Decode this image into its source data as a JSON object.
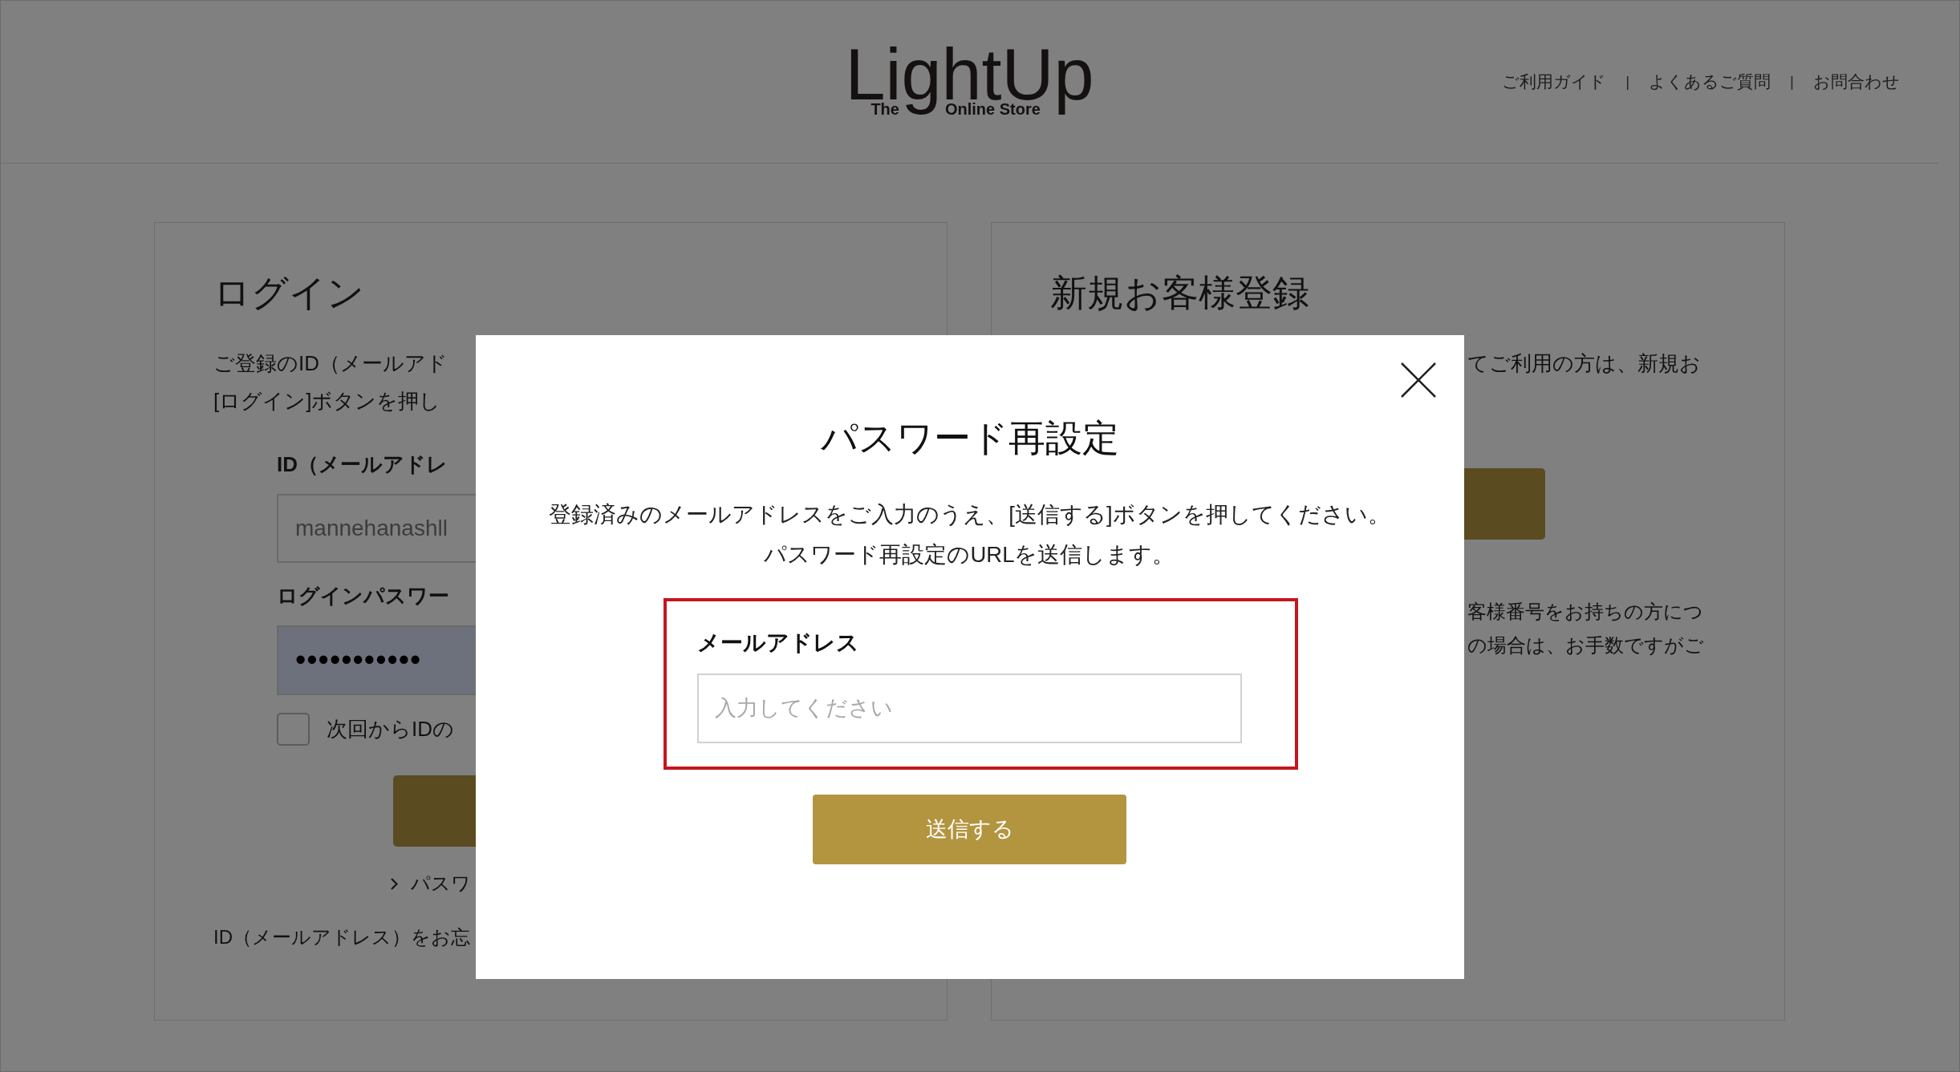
{
  "header": {
    "logo": {
      "wordmark": "LightUp",
      "tagline": [
        "The",
        "Online Store"
      ]
    },
    "links": [
      {
        "kind": "link",
        "label": "ご利用ガイド"
      },
      {
        "kind": "separator",
        "label": "|"
      },
      {
        "kind": "link",
        "label": "よくあるご質問"
      },
      {
        "kind": "separator",
        "label": "|"
      },
      {
        "kind": "link",
        "label": "お問合わせ"
      }
    ]
  },
  "login_panel": {
    "title": "ログイン",
    "intro_lines": [
      "ご登録のID（メールアド",
      "[ログイン]ボタンを押し"
    ],
    "fields": [
      {
        "kind": "text",
        "label": "ID（メールアドレ",
        "value": "mannehanashll"
      },
      {
        "kind": "password",
        "label": "ログインパスワー",
        "value": "•••••••••••"
      }
    ],
    "remember": {
      "label": "次回からIDの",
      "checked": false
    },
    "forgot_link": "パスワ",
    "note": "ID（メールアドレス）をお忘"
  },
  "register_panel": {
    "title": "新規お客様登録",
    "intro": "てご利用の方は、新規お",
    "note_lines": [
      "客様番号をお持ちの方につ",
      "の場合は、お手数ですがご"
    ]
  },
  "modal": {
    "title": "パスワード再設定",
    "message_lines": [
      "登録済みのメールアドレスをご入力のうえ、[送信する]ボタンを押してください。",
      "パスワード再設定のURLを送信します。"
    ],
    "email_field": {
      "label": "メールアドレス",
      "placeholder": "入力してください"
    },
    "submit_button": "送信する"
  }
}
